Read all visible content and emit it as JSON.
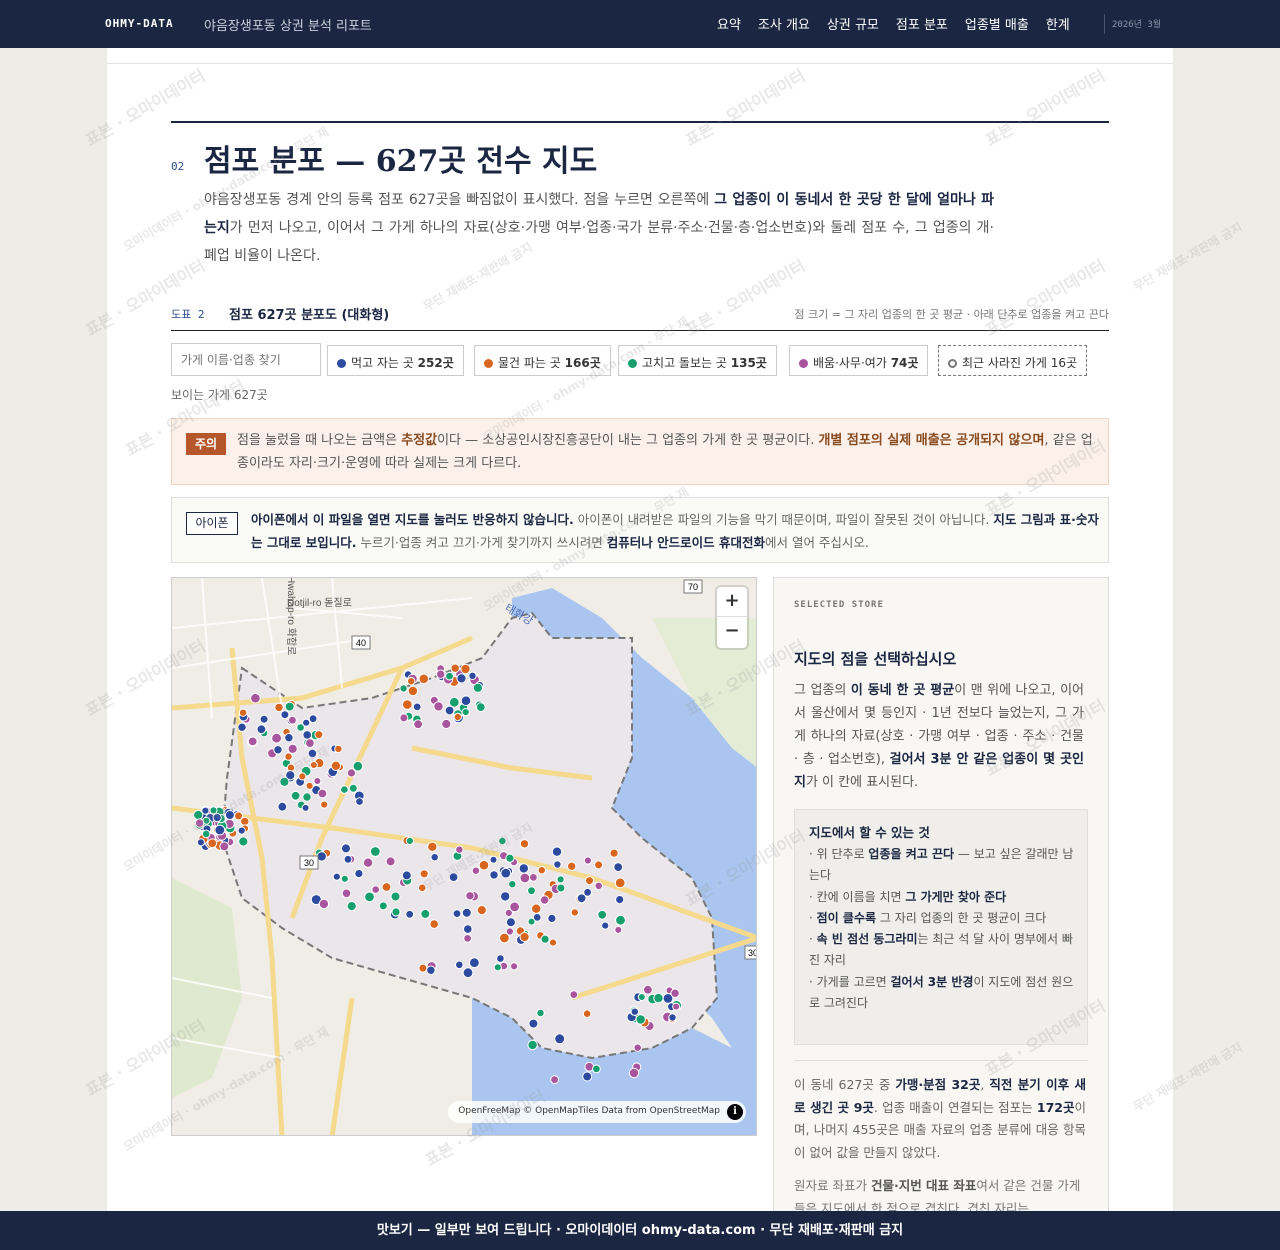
{
  "header": {
    "brand": "OHMY-DATA",
    "subtitle": "야음장생포동 상권 분석 리포트",
    "nav": [
      "요약",
      "조사 개요",
      "상권 규모",
      "점포 분포",
      "업종별 매출",
      "한계"
    ],
    "date": "2026년 3월"
  },
  "section": {
    "number": "02",
    "title": "점포 분포 — 627곳 전수 지도",
    "lead_a": "야음장생포동 경계 안의 등록 점포 627곳을 빠짐없이 표시했다. 점을 누르면 오른쪽에 ",
    "lead_b": "그 업종이 이 동네서 한 곳당 한 달에 얼마나 파는지",
    "lead_c": "가 먼저 나오고, 이어서 그 가게 하나의 자료(상호·가맹 여부·업종·국가 분류·주소·건물·층·업소번호)와 둘레 점포 수, 그 업종의 개·폐업 비율이 나온다."
  },
  "figure": {
    "label": "도표 2",
    "title": "점포 627곳 분포도 (대화형)",
    "note": "점 크기 = 그 자리 업종의 한 곳 평균 · 아래 단추로 업종을 켜고 끈다"
  },
  "filters": {
    "search_placeholder": "가게 이름·업종 찾기",
    "chips": [
      {
        "label": "먹고 자는 곳",
        "count": "252곳",
        "color": "#2c4a9e"
      },
      {
        "label": "물건 파는 곳",
        "count": "166곳",
        "color": "#d9661f"
      },
      {
        "label": "고치고 돌보는 곳",
        "count": "135곳",
        "color": "#17a06e"
      },
      {
        "label": "배움·사무·여가",
        "count": "74곳",
        "color": "#a8559e"
      },
      {
        "label": "최근 사라진 가게 16곳",
        "count": "",
        "color": "#777777"
      }
    ],
    "visible_count": "보이는 가게 627곳"
  },
  "notice": {
    "tag": "주의",
    "text_a": "점을 눌렀을 때 나오는 금액은 ",
    "text_b": "추정값",
    "text_c": "이다 — 소상공인시장진흥공단이 내는 그 업종의 가게 한 곳 평균이다. ",
    "text_d": "개별 점포의 실제 매출은 공개되지 않으며",
    "text_e": ", 같은 업종이라도 자리·크기·운영에 따라 실제는 크게 다르다."
  },
  "iphone": {
    "tag": "아이폰",
    "text_a": "아이폰에서 이 파일을 열면 지도를 눌러도 반응하지 않습니다.",
    "text_b": " 아이폰이 내려받은 파일의 기능을 막기 때문이며, 파일이 잘못된 것이 아닙니다. ",
    "text_c": "지도 그림과 표·숫자는 그대로 보입니다.",
    "text_d": " 누르기·업종 켜고 끄기·가게 찾기까지 쓰시려면 ",
    "text_e": "컴퓨터나 안드로이드 휴대전화",
    "text_f": "에서 열어 주십시오."
  },
  "map": {
    "zoom_in": "+",
    "zoom_out": "−",
    "attribution": "OpenFreeMap © OpenMapTiles Data from OpenStreetMap",
    "info": "i",
    "road_labels": [
      "Dotjil-ro 돋질로",
      "Hwahap-ro 화합로",
      "태화강"
    ],
    "route_shields": [
      "70",
      "40",
      "30",
      "30"
    ]
  },
  "panel": {
    "tag": "SELECTED STORE",
    "title": "지도의 점을 선택하십시오",
    "text_a": "그 업종의 ",
    "text_b": "이 동네 한 곳 평균",
    "text_c": "이 맨 위에 나오고, 이어서 울산에서 몇 등인지 · 1년 전보다 늘었는지, 그 가게 하나의 자료(상호 · 가맹 여부 · 업종 · 주소 · 건물 · 층 · 업소번호), ",
    "text_d": "걸어서 3분 안 같은 업종이 몇 곳인지",
    "text_e": "가 이 칸에 표시된다.",
    "howto_title": "지도에서 할 수 있는 것",
    "howto": [
      {
        "pre": "· 위 단추로 ",
        "bold": "업종을 켜고 끈다",
        "post": " — 보고 싶은 갈래만 남는다"
      },
      {
        "pre": "· 칸에 이름을 치면 ",
        "bold": "그 가게만 찾아 준다",
        "post": ""
      },
      {
        "pre": "· ",
        "bold": "점이 클수록",
        "post": " 그 자리 업종의 한 곳 평균이 크다"
      },
      {
        "pre": "· ",
        "bold": "속 빈 점선 동그라미",
        "post": "는 최근 석 달 사이 명부에서 빠진 자리"
      },
      {
        "pre": "· 가게를 고르면 ",
        "bold": "걸어서 3분 반경",
        "post": "이 지도에 점선 원으로 그려진다"
      }
    ],
    "stat_a": "이 동네 627곳 중 ",
    "stat_b": "가맹·분점 32곳",
    "stat_c": ", ",
    "stat_d": "직전 분기 이후 새로 생긴 곳 9곳",
    "stat_e": ". 업종 매출이 연결되는 점포는 ",
    "stat_f": "172곳",
    "stat_g": "이며, 나머지 455곳은 매출 자료의 업종 분류에 대응 항목이 없어 값을 만들지 않았다.",
    "raw_a": "원자료 좌표가 ",
    "raw_b": "건물·지번 대표 좌표",
    "raw_c": "여서 같은 건물 가게들은 지도에서 한 점으로 겹친다. 겹친 자리는"
  },
  "footer": {
    "text": "맛보기 — 일부만 보여 드립니다 · 오마이데이터 ohmy-data.com · 무단 재배포·재판매 금지"
  },
  "watermark": {
    "a": "표본 · 오마이데이터",
    "b": "오마이데이터 · ohmy-data.com · 무단 재",
    "c": "무단 재배포·재판매 금지"
  }
}
